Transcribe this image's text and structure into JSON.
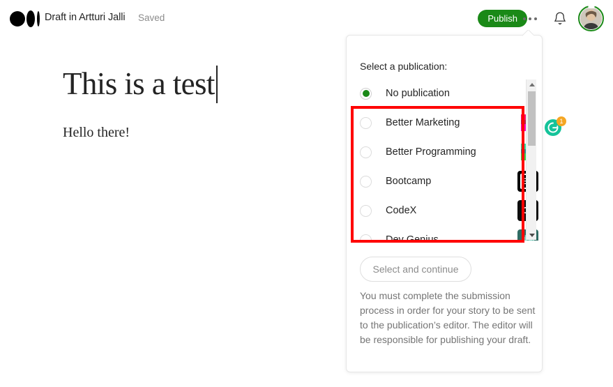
{
  "header": {
    "logo_icon": "medium-logo-icon",
    "draft_title": "Draft in Artturi Jalli",
    "saved_label": "Saved",
    "publish_label": "Publish",
    "more_icon": "ellipsis-icon",
    "bell_icon": "bell-icon",
    "avatar_icon": "user-avatar",
    "accent_green": "#1a8917"
  },
  "article": {
    "title": "This is a test",
    "body": "Hello there!"
  },
  "grammarly": {
    "icon": "grammarly-icon",
    "badge_count": "1",
    "badge_color": "#f5a623",
    "icon_color": "#15c39a"
  },
  "popover": {
    "prompt": "Select a publication:",
    "publications": [
      {
        "name": "No publication",
        "selected": true,
        "logo": "none"
      },
      {
        "name": "Better Marketing",
        "selected": false,
        "logo": "better-marketing-logo"
      },
      {
        "name": "Better Programming",
        "selected": false,
        "logo": "better-programming-logo"
      },
      {
        "name": "Bootcamp",
        "selected": false,
        "logo": "bootcamp-logo",
        "logo_text": "BC"
      },
      {
        "name": "CodeX",
        "selected": false,
        "logo": "codex-logo",
        "logo_text": "CX"
      },
      {
        "name": "Dev Genius",
        "selected": false,
        "logo": "dev-genius-logo"
      }
    ],
    "continue_label": "Select and continue",
    "help_text": "You must complete the submission process in order for your story to be sent to the publication’s editor. The editor will be responsible for publishing your draft.",
    "scrollbar": {
      "up_icon": "scroll-up-arrow-icon",
      "down_icon": "scroll-down-arrow-icon"
    }
  },
  "annotation": {
    "color": "#ff0000"
  }
}
